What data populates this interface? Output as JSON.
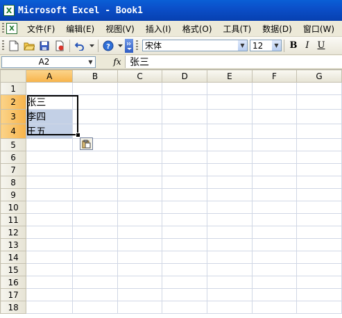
{
  "window": {
    "title": "Microsoft Excel - Book1",
    "app_icon": "excel-icon"
  },
  "menu": {
    "items": [
      "文件(F)",
      "编辑(E)",
      "视图(V)",
      "插入(I)",
      "格式(O)",
      "工具(T)",
      "数据(D)",
      "窗口(W)"
    ]
  },
  "toolbar": {
    "font_name": "宋体",
    "font_size": "12",
    "bold_label": "B",
    "italic_label": "I",
    "underline_label": "U"
  },
  "formula_bar": {
    "name_box": "A2",
    "fx_label": "fx",
    "content": "张三"
  },
  "sheet": {
    "columns": [
      "A",
      "B",
      "C",
      "D",
      "E",
      "F",
      "G"
    ],
    "rows": [
      "1",
      "2",
      "3",
      "4",
      "5",
      "6",
      "7",
      "8",
      "9",
      "10",
      "11",
      "12",
      "13",
      "14",
      "15",
      "16",
      "17",
      "18"
    ],
    "active_cell": "A2",
    "selected_range": "A2:A4",
    "cells": {
      "A2": "张三",
      "A3": "李四",
      "A4": "王五"
    }
  },
  "colors": {
    "title_bar": "#0a5fd6",
    "selection_fill": "#c3d0e6",
    "header_selected": "#f7b34a"
  }
}
